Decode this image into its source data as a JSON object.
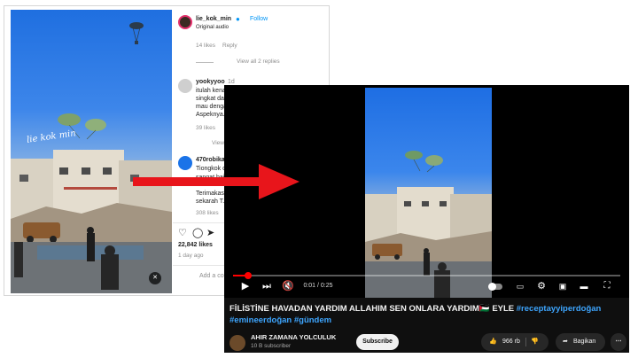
{
  "instagram": {
    "photo_caption": "lie kok min",
    "header": {
      "username": "lie_kok_min",
      "follow_label": "Follow",
      "audio": "Original audio"
    },
    "comment_actions": {
      "likes": "14 likes",
      "reply": "Reply"
    },
    "view_replies": "View all 2 replies",
    "comment1": {
      "username": "yookyyoo",
      "time": "1d",
      "lines": [
        "itulah kena...",
        "singkat dan...",
        "mau dengan...",
        "Aspeknya..."
      ],
      "likes": "39 likes"
    },
    "view_more": "View",
    "comment2": {
      "username": "470robika",
      "lines": [
        "Tiongkok c...",
        "sangat baja...",
        "Terimakas...",
        "sekarah T..."
      ],
      "likes": "308 likes"
    },
    "post_likes": "22,842 likes",
    "post_date": "1 day ago",
    "add_comment_placeholder": "Add a com"
  },
  "youtube": {
    "time_display": "0:01 / 0:25",
    "progress_fraction": 0.04,
    "title_plain": "FİLİSTİNE HAVADAN YARDIM ALLAHIM SEN ONLARA YARDIM🇵🇸 EYLE ",
    "title_tag1": "#receptayyiperdoğan",
    "title_tag2": "#emineerdoğan",
    "title_tag3": "#gündem",
    "channel_name": "AHIR ZAMANA YOLCULUK",
    "channel_subs": "10 B subscriber",
    "subscribe_label": "Subscribe",
    "likes": "966 rb",
    "share_label": "Bagikan"
  },
  "colors": {
    "arrow": "#e8151b",
    "progress": "#ff0000",
    "link": "#3ea6ff",
    "ig_link": "#0095f6"
  }
}
